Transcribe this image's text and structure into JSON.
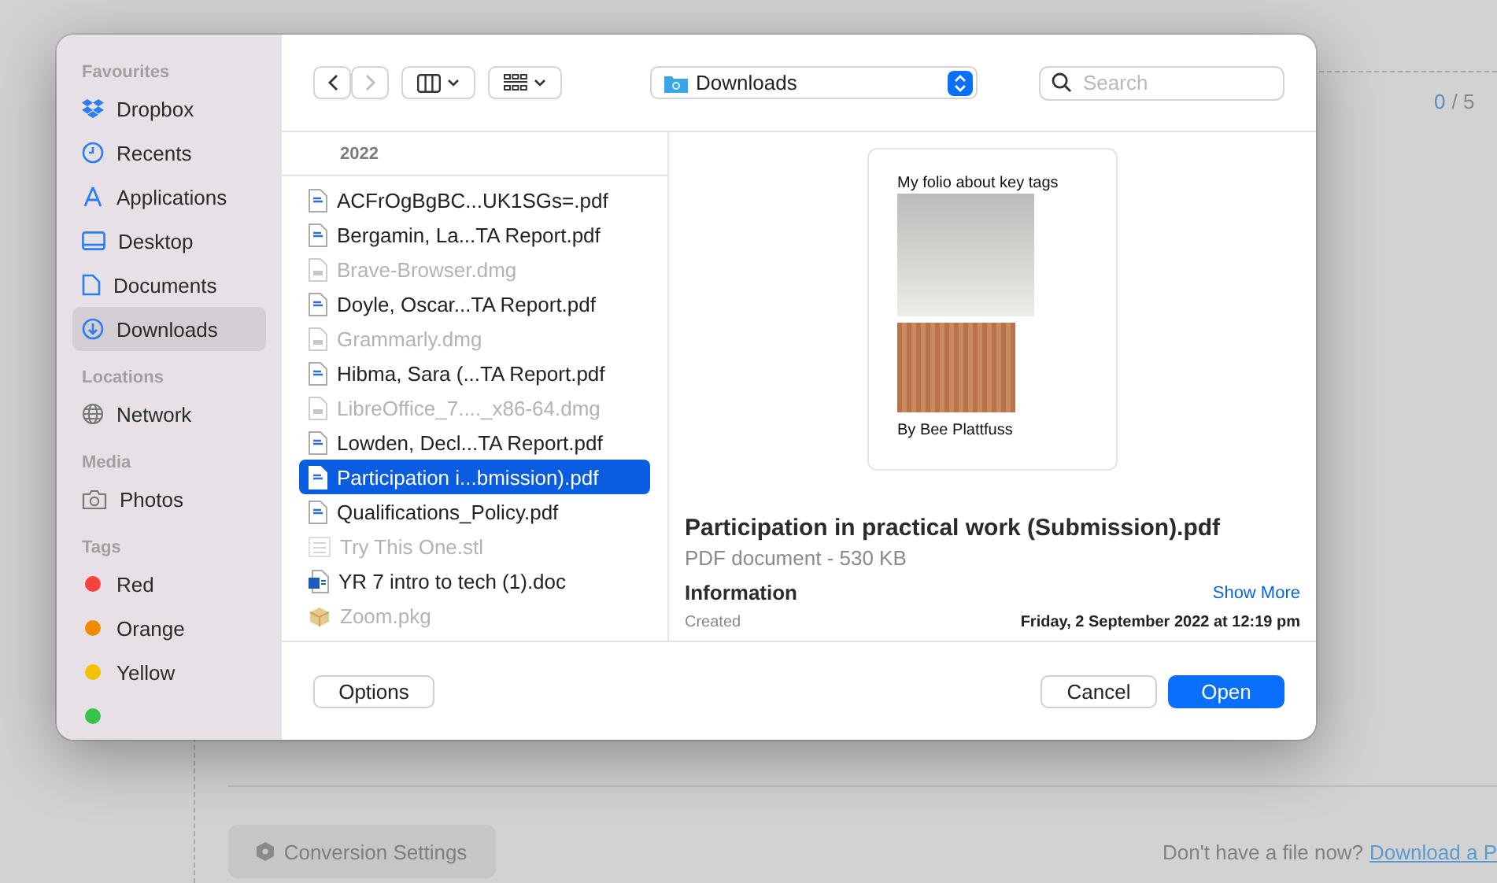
{
  "page": {
    "counter": {
      "current": "0",
      "total": "/ 5"
    },
    "conversion_button": "Conversion Settings",
    "footer_text": "Don't have a file now?",
    "footer_link": "Download a P"
  },
  "dialog": {
    "sidebar": [
      {
        "heading": "Favourites",
        "items": [
          {
            "label": "Dropbox",
            "kind": "dropbox",
            "selected": false
          },
          {
            "label": "Recents",
            "kind": "clock",
            "selected": false
          },
          {
            "label": "Applications",
            "kind": "apps",
            "selected": false
          },
          {
            "label": "Desktop",
            "kind": "desktop",
            "selected": false
          },
          {
            "label": "Documents",
            "kind": "document",
            "selected": false
          },
          {
            "label": "Downloads",
            "kind": "download",
            "selected": true
          }
        ]
      },
      {
        "heading": "Locations",
        "items": [
          {
            "label": "Network",
            "kind": "globe",
            "selected": false
          }
        ]
      },
      {
        "heading": "Media",
        "items": [
          {
            "label": "Photos",
            "kind": "camera",
            "selected": false
          }
        ]
      },
      {
        "heading": "Tags",
        "items": [
          {
            "label": "Red",
            "color": "#f5433b",
            "selected": false
          },
          {
            "label": "Orange",
            "color": "#f08a00",
            "selected": false
          },
          {
            "label": "Yellow",
            "color": "#f2c200",
            "selected": false
          },
          {
            "color": "#38c448",
            "selected": false
          }
        ]
      }
    ],
    "location": "Downloads",
    "search": {
      "placeholder": "Search"
    },
    "list_header": "2022",
    "files": [
      {
        "name": "ACFrOgBgBC...UK1SGs=.pdf",
        "kind": "pdf",
        "disabled": false,
        "selected": false
      },
      {
        "name": "Bergamin, La...TA Report.pdf",
        "kind": "pdf",
        "disabled": false,
        "selected": false
      },
      {
        "name": "Brave-Browser.dmg",
        "kind": "dmg",
        "disabled": true,
        "selected": false
      },
      {
        "name": "Doyle, Oscar...TA Report.pdf",
        "kind": "pdf",
        "disabled": false,
        "selected": false
      },
      {
        "name": "Grammarly.dmg",
        "kind": "dmg",
        "disabled": true,
        "selected": false
      },
      {
        "name": "Hibma, Sara (...TA Report.pdf",
        "kind": "pdf",
        "disabled": false,
        "selected": false
      },
      {
        "name": "LibreOffice_7...._x86-64.dmg",
        "kind": "dmg",
        "disabled": true,
        "selected": false
      },
      {
        "name": "Lowden, Decl...TA Report.pdf",
        "kind": "pdf",
        "disabled": false,
        "selected": false
      },
      {
        "name": "Participation i...bmission).pdf",
        "kind": "pdf",
        "disabled": false,
        "selected": true
      },
      {
        "name": "Qualifications_Policy.pdf",
        "kind": "pdf",
        "disabled": false,
        "selected": false
      },
      {
        "name": "Try This One.stl",
        "kind": "stl",
        "disabled": true,
        "selected": false
      },
      {
        "name": "YR 7 intro to tech (1).doc",
        "kind": "doc",
        "disabled": false,
        "selected": false
      },
      {
        "name": "Zoom.pkg",
        "kind": "pkg",
        "disabled": true,
        "selected": false
      }
    ],
    "preview": {
      "thumb_title": "My folio about key tags",
      "thumb_caption": "By Bee Plattfuss",
      "title": "Participation in practical work (Submission).pdf",
      "subtitle": "PDF document - 530 KB",
      "info_heading": "Information",
      "show_more": "Show More",
      "info": [
        {
          "label": "Created",
          "value": "Friday, 2 September 2022 at 12:19 pm"
        }
      ]
    },
    "buttons": {
      "options": "Options",
      "cancel": "Cancel",
      "open": "Open"
    }
  }
}
